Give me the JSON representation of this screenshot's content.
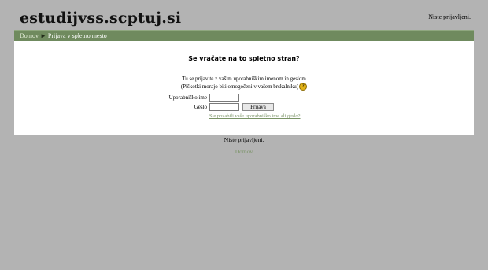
{
  "header": {
    "site_title": "estudijvss.scptuj.si",
    "login_info": "Niste prijavljeni."
  },
  "navbar": {
    "home": "Domov",
    "separator": "►",
    "current": "Prijava v spletno mesto"
  },
  "login": {
    "heading": "Se vračate na to spletno stran?",
    "intro_line1": "Tu se prijavite z vašim uporabniškim imenom in geslom",
    "intro_line2": "(Piškotki morajo biti omogočeni v vašem brskalniku)",
    "help_icon": "?",
    "username_label": "Uporabniško ime",
    "password_label": "Geslo",
    "username_value": "",
    "password_value": "",
    "submit_label": "Prijava",
    "forgot_link": "Ste pozabili vaše uporabniško ime ali geslo?"
  },
  "footer": {
    "login_info": "Niste prijavljeni.",
    "home_link": "Domov"
  }
}
